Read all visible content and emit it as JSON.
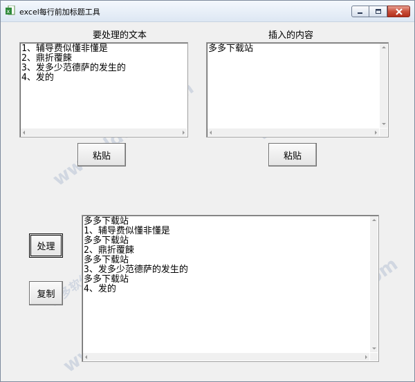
{
  "window": {
    "title": "excel每行前加标题工具",
    "controls": [
      "minimize",
      "maximize",
      "close"
    ]
  },
  "left_panel": {
    "heading": "要处理的文本",
    "text": "1、辅导费似懂非懂是\n2、鼎折覆餗\n3、发多少范德萨的发生的\n4、发的",
    "paste_label": "粘贴"
  },
  "right_panel": {
    "heading": "插入的内容",
    "text": "多多下载站",
    "paste_label": "粘贴"
  },
  "actions": {
    "process_label": "处理",
    "copy_label": "复制"
  },
  "output": {
    "text": "多多下载站\n1、辅导费似懂非懂是\n多多下载站\n2、鼎折覆餗\n多多下载站\n3、发多少范德萨的发生的\n多多下载站\n4、发的"
  },
  "watermarks": {
    "site_text": "www.ddooo.com",
    "brand_text": "多多软件站"
  },
  "colors": {
    "window_bg": "#f0f0f0",
    "close_button": "#c9503b",
    "watermark": "#b8c4d6"
  }
}
